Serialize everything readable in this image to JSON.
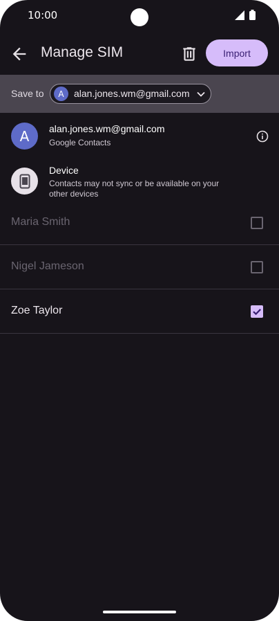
{
  "status_bar": {
    "time": "10:00",
    "signal_icon": "signal-icon",
    "battery_icon": "battery-icon"
  },
  "top_bar": {
    "title": "Manage SIM",
    "back_icon": "arrow-back-icon",
    "delete_icon": "trash-icon",
    "import_label": "Import",
    "accent": "#d6bcfa"
  },
  "save_to": {
    "label": "Save to",
    "account_initial": "A",
    "account_email": "alan.jones.wm@gmail.com"
  },
  "destinations": [
    {
      "initial": "A",
      "title": "alan.jones.wm@gmail.com",
      "subtitle": "Google Contacts"
    },
    {
      "title": "Device",
      "subtitle": "Contacts may not sync or be available on your other devices"
    }
  ],
  "contacts": [
    {
      "name": "Maria Smith",
      "checked": false
    },
    {
      "name": "Nigel Jameson",
      "checked": false
    },
    {
      "name": "Zoe Taylor",
      "checked": true
    }
  ]
}
